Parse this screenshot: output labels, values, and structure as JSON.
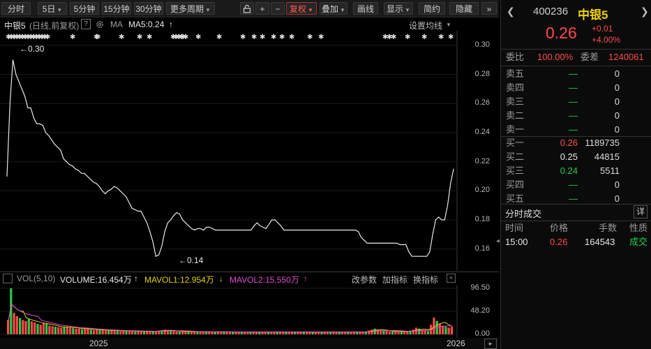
{
  "toolbar": {
    "items": [
      {
        "label": "分时",
        "caret": false
      },
      {
        "label": "5日",
        "caret": true
      },
      {
        "label": "5分钟",
        "caret": false
      },
      {
        "label": "15分钟",
        "caret": false
      },
      {
        "label": "30分钟",
        "caret": false
      },
      {
        "label": "更多周期",
        "caret": true
      }
    ],
    "lock_icon": "lock-icon",
    "plus_label": "+",
    "minus_label": "−",
    "adjust_label": "复权",
    "overlay_label": "叠加",
    "draw_label": "画线",
    "display_label": "显示",
    "simple_label": "简约",
    "hide_label": "隐藏",
    "collapse_label": "»"
  },
  "chart_header": {
    "name": "中银5",
    "mode": "(日线,前复权)",
    "help": "?",
    "ma_label": "MA",
    "ma5": "MA5:0.24",
    "ma5_arrow": "↑",
    "settings": "设置均线",
    "max_label": "←0.30",
    "min_label": "←0.14"
  },
  "volume_header": {
    "name": "VOL(5,10)",
    "volume": "VOLUME:16.454万",
    "volume_arrow": "↑",
    "mavol1": "MAVOL1:12.954万",
    "mavol1_arrow": "↓",
    "mavol2": "MAVOL2:15.550万",
    "mavol2_arrow": "↑",
    "change_params": "改参数",
    "add_indicator": "加指标",
    "switch_indicator": "换指标"
  },
  "x_axis": {
    "labels": [
      "2025",
      "2026"
    ]
  },
  "y_axis_price": [
    "0.30",
    "0.28",
    "0.26",
    "0.24",
    "0.22",
    "0.20",
    "0.18",
    "0.16"
  ],
  "y_axis_volume": [
    "96.50",
    "48.20",
    "0.00"
  ],
  "colors": {
    "up": "#ff4a4a",
    "down": "#22d04a",
    "line": "#e8e8e8",
    "mavol1": "#e6d200",
    "mavol2": "#e04bd8",
    "vol_bar": "#ff4a4a"
  },
  "chart_data": {
    "type": "line",
    "title": "中银5",
    "ylabel": "",
    "ylim": [
      0.145,
      0.31
    ],
    "x": [
      0,
      2,
      4,
      6,
      8,
      10,
      12,
      14,
      16,
      18,
      20,
      22,
      24,
      26,
      28,
      30,
      32,
      34,
      36,
      38,
      40,
      42,
      44,
      46,
      48,
      50,
      52,
      54,
      56,
      58,
      60,
      62,
      64,
      66,
      68,
      70,
      72,
      74,
      76,
      78,
      80,
      82,
      84,
      86,
      88,
      90,
      92,
      94,
      96,
      98,
      100,
      102,
      104,
      106,
      108,
      110,
      112,
      114,
      116,
      118,
      120,
      122,
      124,
      126,
      128,
      130,
      132,
      134,
      136,
      138,
      140,
      142,
      144,
      146,
      148,
      150,
      152,
      154,
      156,
      158,
      160,
      162,
      164,
      166,
      168,
      170,
      172,
      174,
      176,
      178,
      180,
      182,
      184,
      186,
      188,
      190,
      192,
      194,
      196,
      198,
      200,
      202,
      204,
      206,
      208,
      210,
      212,
      214,
      216,
      218,
      220,
      222,
      224,
      226,
      228,
      230,
      232,
      234,
      236,
      238,
      240,
      242,
      244,
      246,
      248,
      250,
      252,
      254,
      256,
      258,
      260,
      262,
      264,
      266,
      268,
      270,
      272,
      274,
      276,
      278,
      280,
      282,
      284,
      286,
      288,
      290,
      292,
      294,
      296,
      298,
      300
    ],
    "series": [
      {
        "values": [
          0.21,
          0.26,
          0.29,
          0.28,
          0.275,
          0.27,
          0.265,
          0.257,
          0.257,
          0.25,
          0.246,
          0.246,
          0.245,
          0.24,
          0.238,
          0.235,
          0.232,
          0.23,
          0.228,
          0.222,
          0.22,
          0.218,
          0.217,
          0.215,
          0.214,
          0.212,
          0.212,
          0.21,
          0.208,
          0.206,
          0.205,
          0.203,
          0.2,
          0.198,
          0.2,
          0.201,
          0.203,
          0.202,
          0.2,
          0.198,
          0.196,
          0.192,
          0.188,
          0.187,
          0.186,
          0.186,
          0.182,
          0.178,
          0.172,
          0.165,
          0.155,
          0.156,
          0.162,
          0.172,
          0.178,
          0.18,
          0.183,
          0.185,
          0.184,
          0.18,
          0.178,
          0.176,
          0.174,
          0.173,
          0.174,
          0.174,
          0.173,
          0.175,
          0.175,
          0.174,
          0.173,
          0.173,
          0.173,
          0.173,
          0.173,
          0.173,
          0.173,
          0.173,
          0.173,
          0.173,
          0.173,
          0.173,
          0.173,
          0.176,
          0.178,
          0.176,
          0.175,
          0.174,
          0.177,
          0.18,
          0.18,
          0.178,
          0.176,
          0.173,
          0.173,
          0.173,
          0.173,
          0.173,
          0.173,
          0.173,
          0.173,
          0.173,
          0.173,
          0.173,
          0.173,
          0.173,
          0.173,
          0.173,
          0.173,
          0.173,
          0.173,
          0.173,
          0.173,
          0.173,
          0.173,
          0.173,
          0.173,
          0.173,
          0.172,
          0.168,
          0.166,
          0.164,
          0.164,
          0.164,
          0.164,
          0.164,
          0.164,
          0.164,
          0.164,
          0.164,
          0.164,
          0.164,
          0.163,
          0.163,
          0.163,
          0.158,
          0.155,
          0.155,
          0.155,
          0.155,
          0.155,
          0.155,
          0.158,
          0.17,
          0.18,
          0.182,
          0.18,
          0.18,
          0.19,
          0.205,
          0.215,
          0.23,
          0.24
        ]
      }
    ]
  },
  "volume_data": {
    "ylim": [
      0,
      96.5
    ],
    "values": [
      30,
      96.5,
      45,
      38,
      34,
      30,
      28,
      32,
      27,
      25,
      22,
      20,
      24,
      22,
      18,
      17,
      16,
      15,
      14,
      16,
      15,
      14,
      13,
      12,
      12,
      11,
      12,
      11,
      10,
      9,
      10,
      9,
      9,
      8,
      8,
      9,
      8,
      8,
      7,
      7,
      8,
      7,
      7,
      6,
      7,
      6,
      6,
      7,
      6,
      6,
      7,
      8,
      9,
      10,
      8,
      7,
      7,
      6,
      6,
      6,
      6,
      6,
      5,
      5,
      5,
      6,
      5,
      5,
      5,
      5,
      5,
      6,
      5,
      5,
      5,
      5,
      5,
      5,
      5,
      5,
      5,
      5,
      5,
      5,
      5,
      5,
      5,
      5,
      5,
      5,
      5,
      5,
      5,
      5,
      5,
      5,
      5,
      5,
      5,
      5,
      5,
      5,
      5,
      5,
      5,
      5,
      5,
      5,
      5,
      5,
      5,
      5,
      5,
      5,
      5,
      5,
      5,
      5,
      5,
      5,
      5,
      6,
      8,
      10,
      12,
      10,
      8,
      7,
      7,
      6,
      6,
      6,
      6,
      6,
      6,
      6,
      8,
      10,
      14,
      12,
      9,
      8,
      7,
      20,
      35,
      28,
      22,
      18,
      16,
      14,
      16
    ]
  },
  "quote": {
    "code": "400236",
    "name": "中银5",
    "price": "0.26",
    "change": "+0.01",
    "change_pct": "+4.00%",
    "wb_label": "委比",
    "wb_value": "100.00%",
    "wc_label": "委差",
    "wc_value": "1240061",
    "asks": [
      {
        "label": "卖五",
        "price": "—",
        "vol": "0"
      },
      {
        "label": "卖四",
        "price": "—",
        "vol": "0"
      },
      {
        "label": "卖三",
        "price": "—",
        "vol": "0"
      },
      {
        "label": "卖二",
        "price": "—",
        "vol": "0"
      },
      {
        "label": "卖一",
        "price": "—",
        "vol": "0"
      }
    ],
    "bids": [
      {
        "label": "买一",
        "price": "0.26",
        "vol": "1189735",
        "color": "red"
      },
      {
        "label": "买二",
        "price": "0.25",
        "vol": "44815",
        "color": "white"
      },
      {
        "label": "买三",
        "price": "0.24",
        "vol": "5511",
        "color": "green"
      },
      {
        "label": "买四",
        "price": "—",
        "vol": "0",
        "color": "green"
      },
      {
        "label": "买五",
        "price": "—",
        "vol": "0",
        "color": "green"
      }
    ],
    "trades_title": "分时成交",
    "detail_label": "详",
    "trade_headers": [
      "时间",
      "价格",
      "手数",
      "性质"
    ],
    "trades": [
      {
        "time": "15:00",
        "price": "0.26",
        "vol": "164543",
        "type": "成交"
      }
    ]
  }
}
